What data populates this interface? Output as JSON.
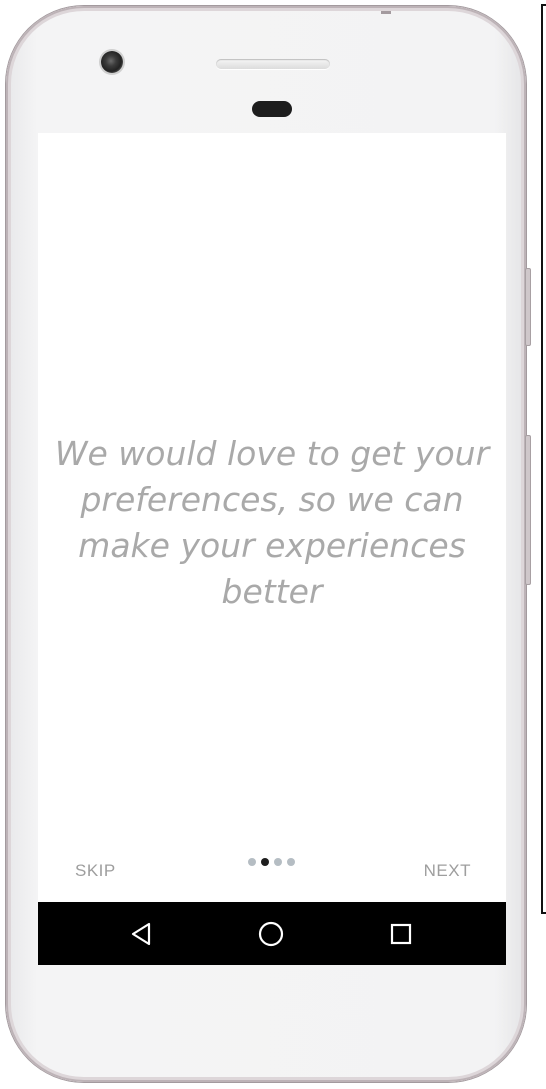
{
  "onboarding": {
    "message": "We would love to get your preferences, so we can make your experiences better",
    "skip_label": "SKIP",
    "next_label": "NEXT",
    "page_indicator": {
      "total": 4,
      "active_index": 1
    }
  },
  "navigation_bar": {
    "buttons": [
      {
        "name": "back",
        "icon": "back-triangle-icon"
      },
      {
        "name": "home",
        "icon": "home-circle-icon"
      },
      {
        "name": "recents",
        "icon": "recents-square-icon"
      }
    ]
  },
  "colors": {
    "message_text": "#a9a9a9",
    "action_text": "#9e9e9e",
    "dot_inactive": "#b5bdc3",
    "dot_active": "#1e1e1e",
    "nav_bar": "#000000",
    "screen_bg": "#ffffff"
  }
}
